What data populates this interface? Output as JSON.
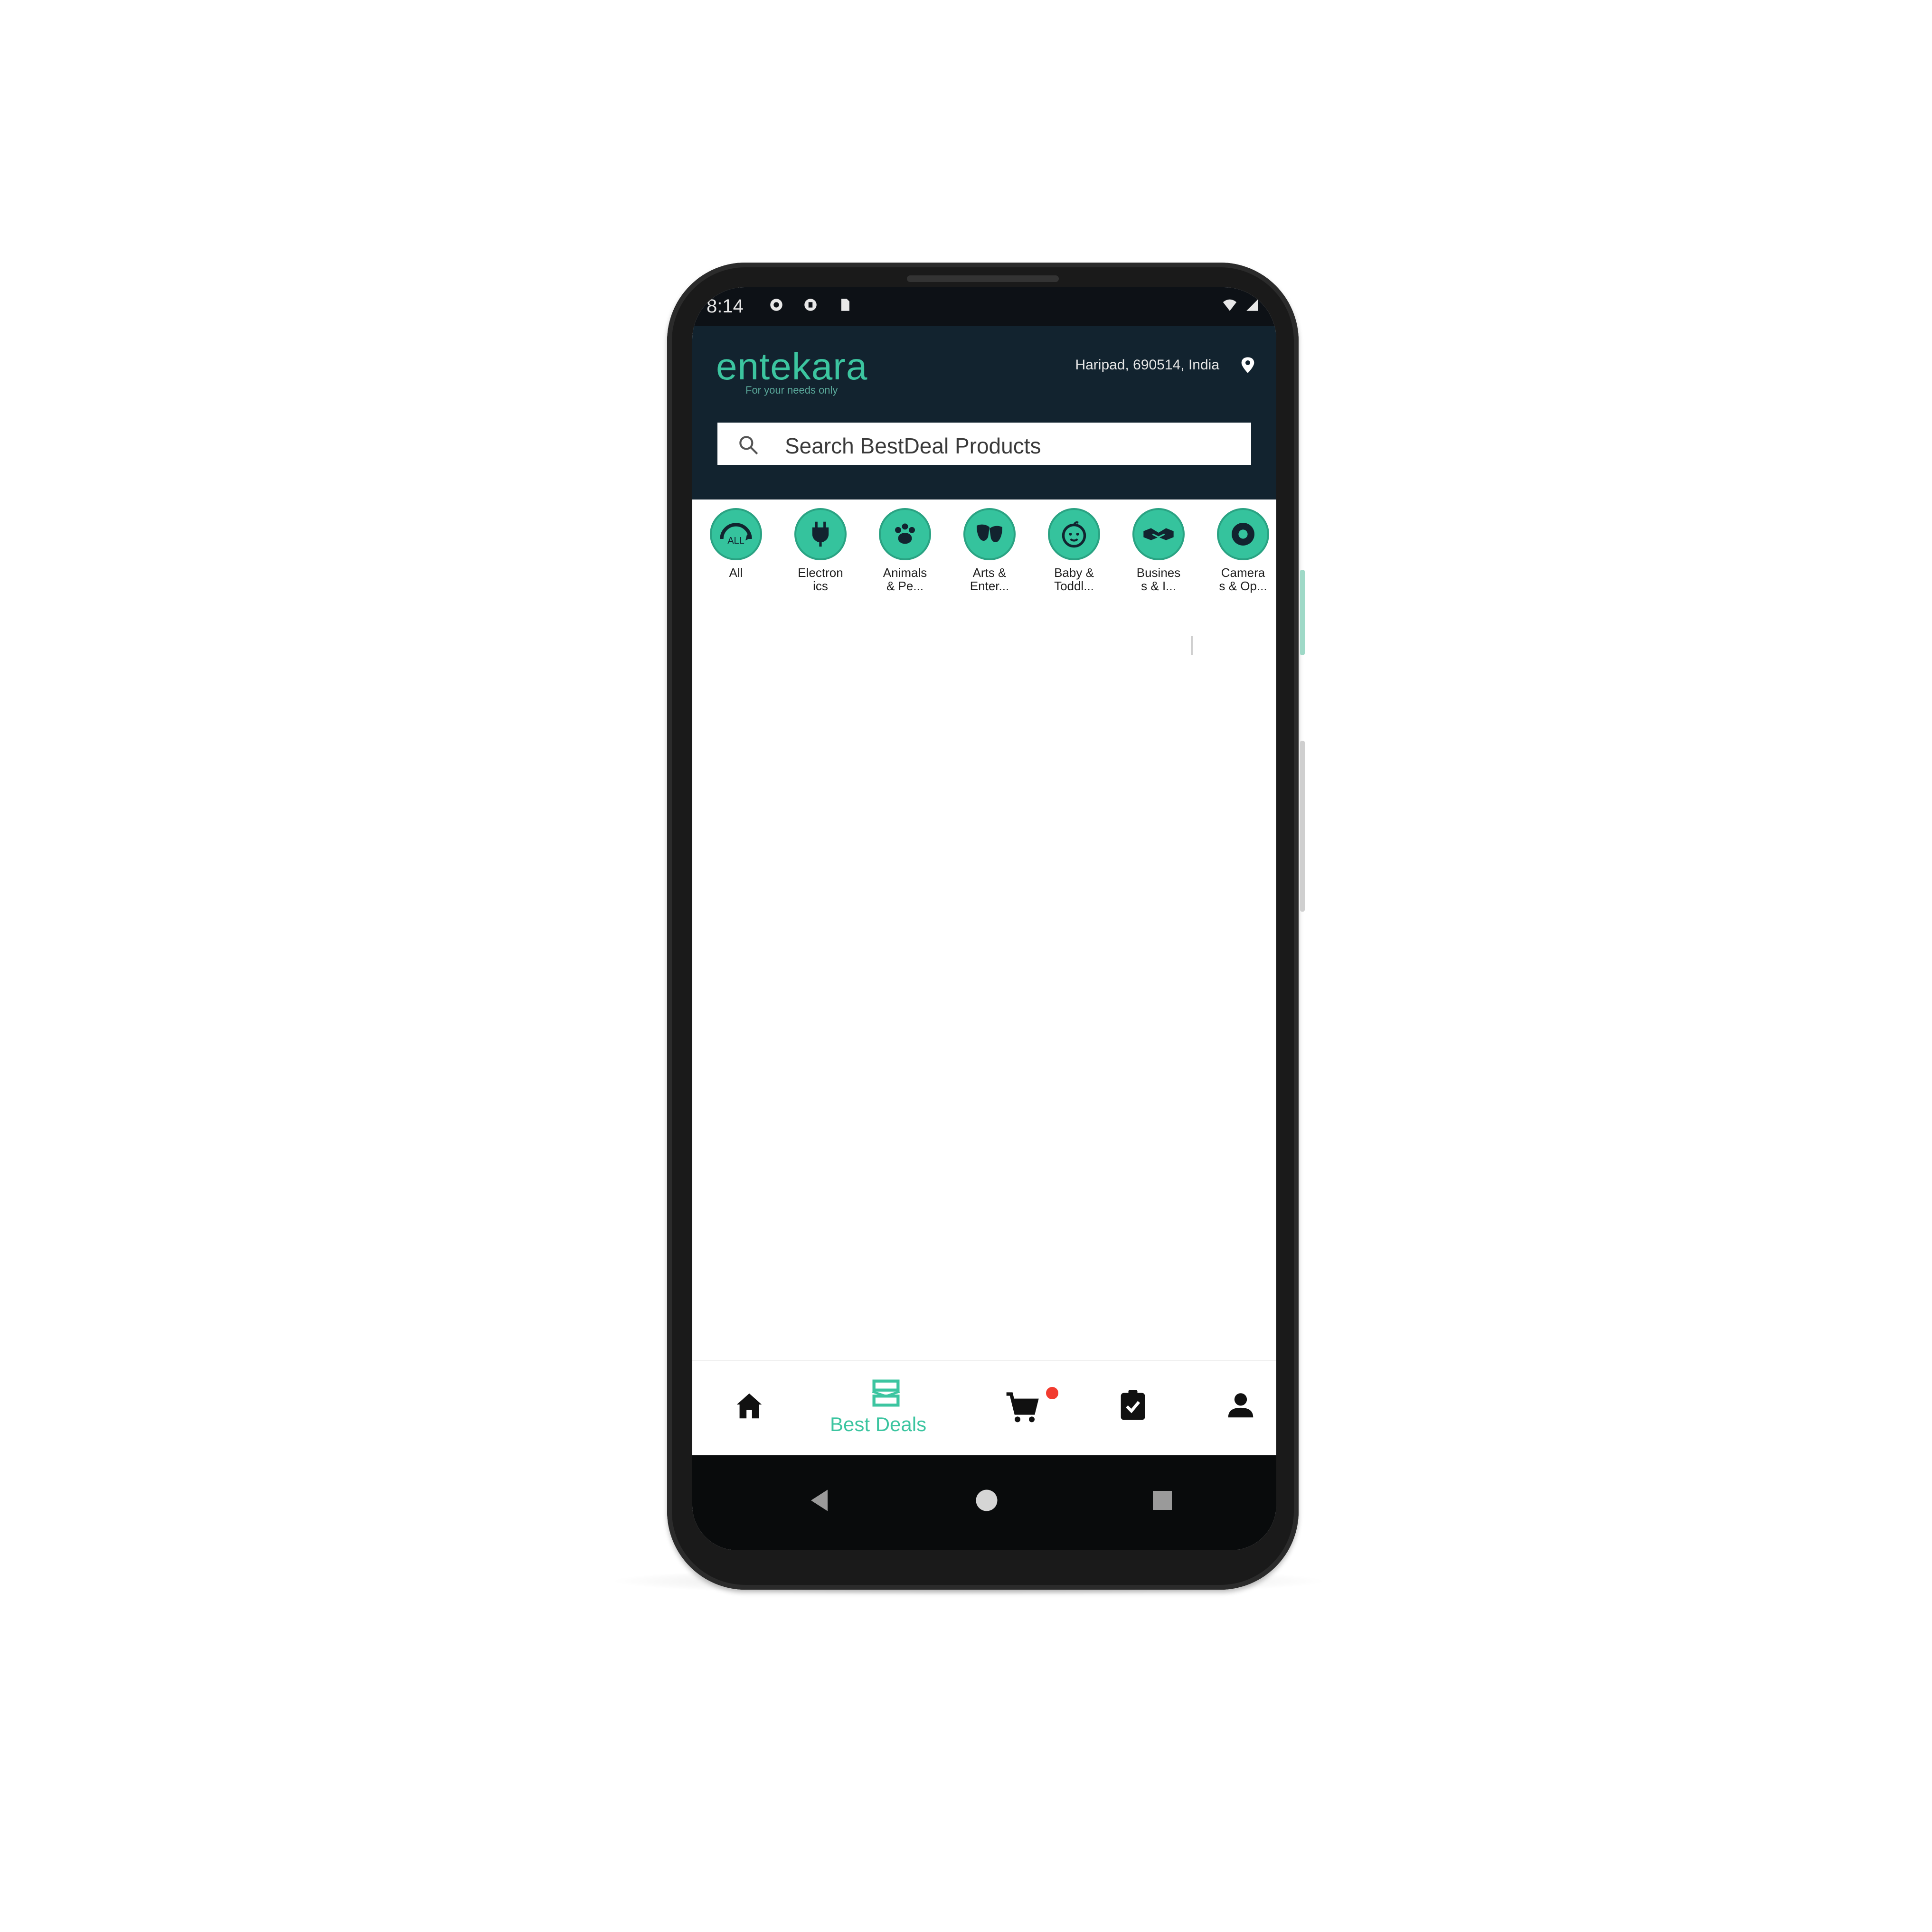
{
  "status_bar": {
    "time": "8:14",
    "icons": [
      "gear-icon",
      "shield-icon",
      "sd-card-icon",
      "wifi-icon",
      "signal-icon"
    ]
  },
  "header": {
    "logo_text": "entekara",
    "tagline": "For your needs only",
    "location": "Haripad, 690514, India",
    "location_icon": "location-pin-icon"
  },
  "search": {
    "placeholder": "Search BestDeal Products"
  },
  "categories": [
    {
      "label_line1": "All",
      "label_line2": "",
      "icon": "all-icon"
    },
    {
      "label_line1": "Electron",
      "label_line2": "ics",
      "icon": "plug-icon"
    },
    {
      "label_line1": "Animals",
      "label_line2": "& Pe...",
      "icon": "paw-icon"
    },
    {
      "label_line1": "Arts &",
      "label_line2": "Enter...",
      "icon": "masks-icon"
    },
    {
      "label_line1": "Baby &",
      "label_line2": "Toddl...",
      "icon": "baby-icon"
    },
    {
      "label_line1": "Busines",
      "label_line2": "s & I...",
      "icon": "handshake-icon"
    },
    {
      "label_line1": "Camera",
      "label_line2": "s & Op...",
      "icon": "camera-icon"
    }
  ],
  "bottom_nav": {
    "items": [
      {
        "icon": "home-icon"
      },
      {
        "icon": "best-deals-icon",
        "label": "Best Deals",
        "active": true
      },
      {
        "icon": "cart-icon",
        "badge": true
      },
      {
        "icon": "orders-icon"
      },
      {
        "icon": "profile-icon"
      }
    ],
    "active_color": "#3cc5a0",
    "badge_color": "#f23b2f"
  },
  "system_nav": [
    "back-icon",
    "home-circle-icon",
    "recents-icon"
  ],
  "colors": {
    "header_bg": "#12232f",
    "accent": "#35c39d"
  }
}
